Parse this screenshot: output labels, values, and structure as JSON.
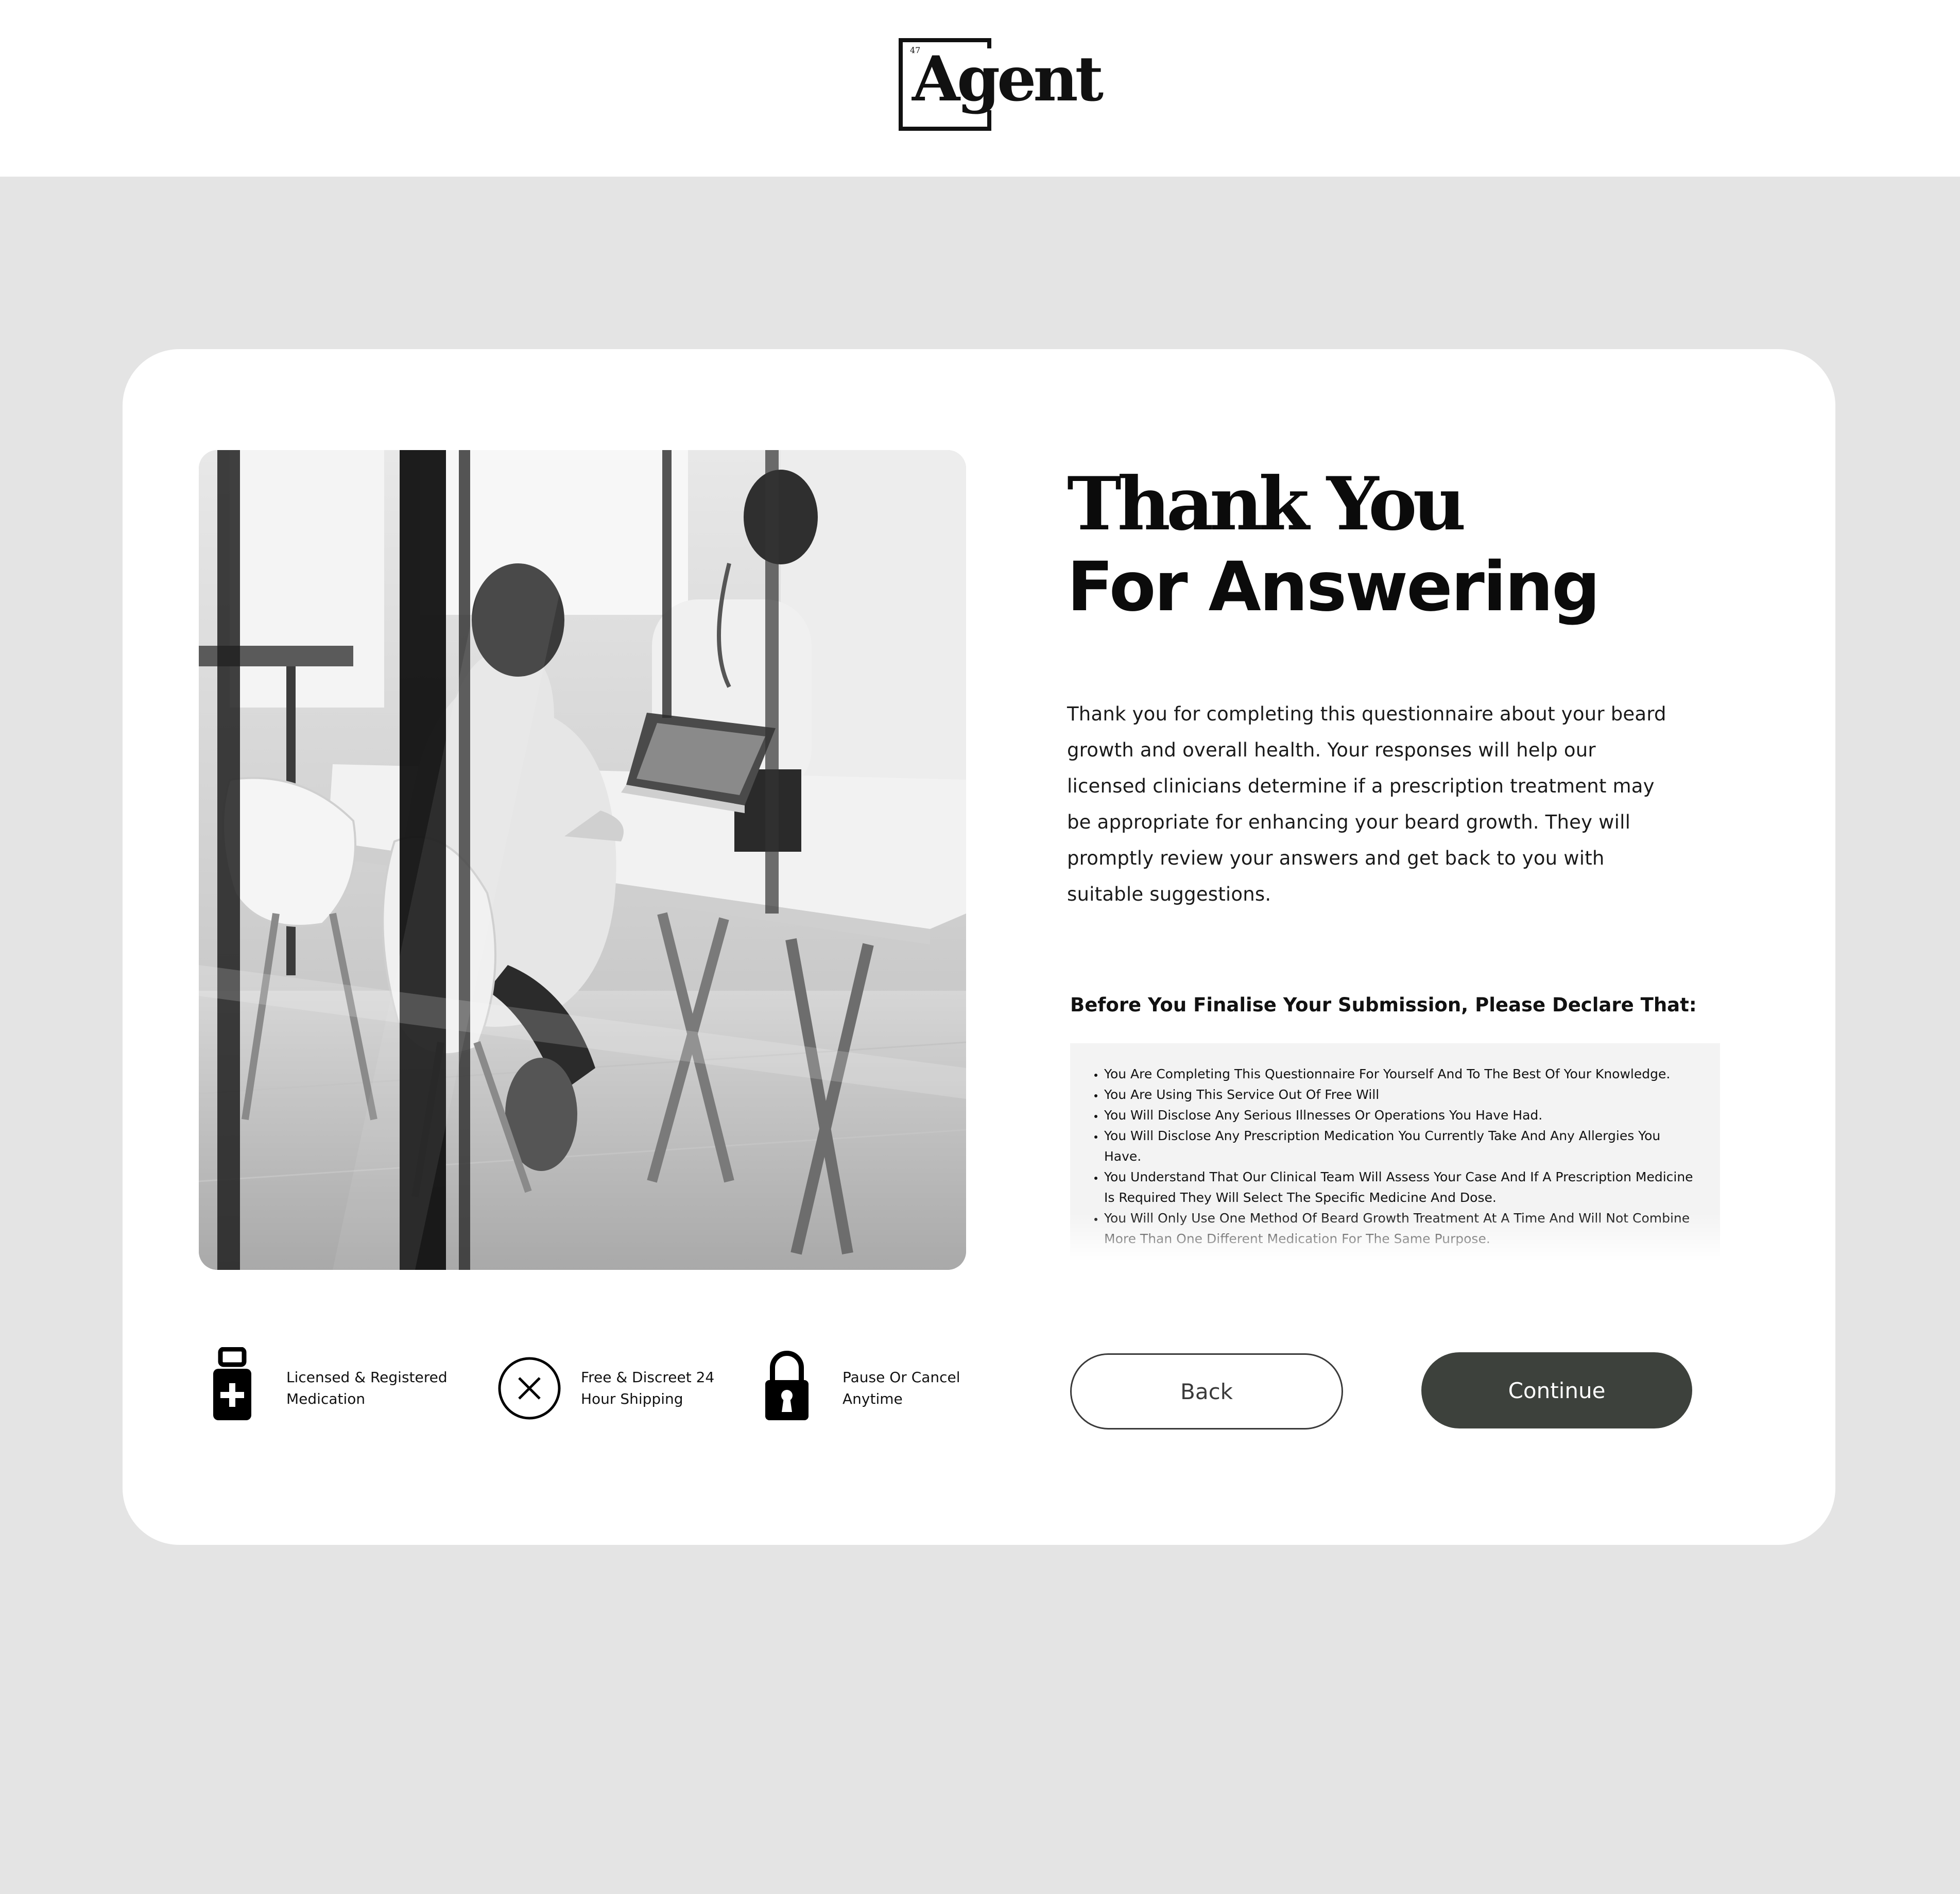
{
  "header": {
    "logo_text": "Agent",
    "logo_number": "47"
  },
  "colors": {
    "page_background": "#e4e4e4",
    "card_background": "#ffffff",
    "declaration_box_background": "#f3f3f3",
    "continue_button": "#3d413c"
  },
  "main": {
    "photo_description_icon": "doctors-meeting-photo",
    "title_line1": "Thank You",
    "title_line2": "For Answering",
    "intro_text": "Thank you for completing this questionnaire about your beard growth and overall health. Your responses will help our licensed clinicians determine if a prescription treatment may be appropriate for enhancing your beard growth. They will promptly review your answers and get back to you with suitable suggestions.",
    "declaration_heading": "Before You Finalise Your Submission, Please Declare That:",
    "declarations": [
      "You Are Completing This Questionnaire For Yourself And To The Best Of Your Knowledge.",
      "You Are Using This Service Out Of Free Will",
      "You Will Disclose Any Serious Illnesses Or Operations You Have Had.",
      "You Will Disclose Any Prescription Medication You Currently Take And Any Allergies You Have.",
      "You Understand That Our Clinical Team Will Assess Your Case And If A Prescription Medicine Is Required They Will Select The Specific Medicine And Dose.",
      "You Will Only Use One Method Of Beard Growth Treatment At A Time And Will Not Combine More Than One Different Medication For The Same Purpose."
    ]
  },
  "features": [
    {
      "icon": "medicine-bottle-icon",
      "line1": "Licensed & Registered",
      "line2": "Medication"
    },
    {
      "icon": "close-circle-icon",
      "line1": "Free & Discreet 24",
      "line2": "Hour Shipping"
    },
    {
      "icon": "padlock-icon",
      "line1": "Pause Or Cancel",
      "line2": "Anytime"
    }
  ],
  "actions": {
    "back_label": "Back",
    "continue_label": "Continue"
  }
}
